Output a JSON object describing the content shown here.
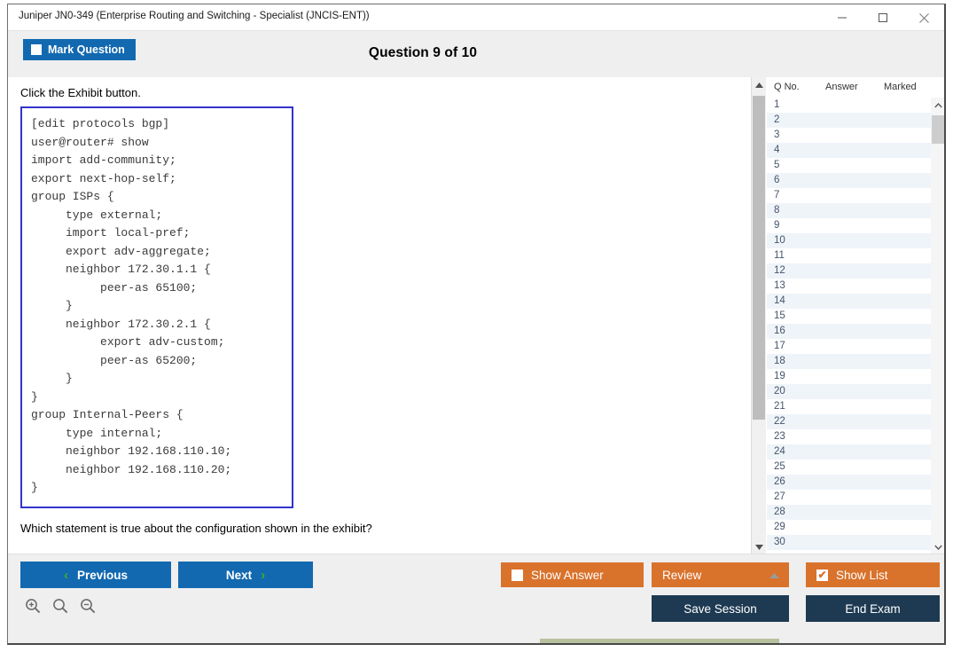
{
  "window": {
    "title": "Juniper JN0-349 (Enterprise Routing and Switching - Specialist (JNCIS-ENT))",
    "minimize_label": "minimize",
    "maximize_label": "maximize",
    "close_label": "close"
  },
  "header": {
    "mark_question_label": "Mark Question",
    "question_title": "Question 9 of 10"
  },
  "main": {
    "prompt": "Click the Exhibit button.",
    "exhibit_code": "[edit protocols bgp]\nuser@router# show\nimport add-community;\nexport next-hop-self;\ngroup ISPs {\n     type external;\n     import local-pref;\n     export adv-aggregate;\n     neighbor 172.30.1.1 {\n          peer-as 65100;\n     }\n     neighbor 172.30.2.1 {\n          export adv-custom;\n          peer-as 65200;\n     }\n}\ngroup Internal-Peers {\n     type internal;\n     neighbor 192.168.110.10;\n     neighbor 192.168.110.20;\n}",
    "question": "Which statement is true about the configuration shown in the exhibit?"
  },
  "question_list": {
    "columns": [
      "Q No.",
      "Answer",
      "Marked"
    ],
    "rows": [
      {
        "qno": "1",
        "answer": "",
        "marked": ""
      },
      {
        "qno": "2",
        "answer": "",
        "marked": ""
      },
      {
        "qno": "3",
        "answer": "",
        "marked": ""
      },
      {
        "qno": "4",
        "answer": "",
        "marked": ""
      },
      {
        "qno": "5",
        "answer": "",
        "marked": ""
      },
      {
        "qno": "6",
        "answer": "",
        "marked": ""
      },
      {
        "qno": "7",
        "answer": "",
        "marked": ""
      },
      {
        "qno": "8",
        "answer": "",
        "marked": ""
      },
      {
        "qno": "9",
        "answer": "",
        "marked": ""
      },
      {
        "qno": "10",
        "answer": "",
        "marked": ""
      },
      {
        "qno": "11",
        "answer": "",
        "marked": ""
      },
      {
        "qno": "12",
        "answer": "",
        "marked": ""
      },
      {
        "qno": "13",
        "answer": "",
        "marked": ""
      },
      {
        "qno": "14",
        "answer": "",
        "marked": ""
      },
      {
        "qno": "15",
        "answer": "",
        "marked": ""
      },
      {
        "qno": "16",
        "answer": "",
        "marked": ""
      },
      {
        "qno": "17",
        "answer": "",
        "marked": ""
      },
      {
        "qno": "18",
        "answer": "",
        "marked": ""
      },
      {
        "qno": "19",
        "answer": "",
        "marked": ""
      },
      {
        "qno": "20",
        "answer": "",
        "marked": ""
      },
      {
        "qno": "21",
        "answer": "",
        "marked": ""
      },
      {
        "qno": "22",
        "answer": "",
        "marked": ""
      },
      {
        "qno": "23",
        "answer": "",
        "marked": ""
      },
      {
        "qno": "24",
        "answer": "",
        "marked": ""
      },
      {
        "qno": "25",
        "answer": "",
        "marked": ""
      },
      {
        "qno": "26",
        "answer": "",
        "marked": ""
      },
      {
        "qno": "27",
        "answer": "",
        "marked": ""
      },
      {
        "qno": "28",
        "answer": "",
        "marked": ""
      },
      {
        "qno": "29",
        "answer": "",
        "marked": ""
      },
      {
        "qno": "30",
        "answer": "",
        "marked": ""
      }
    ]
  },
  "footer": {
    "previous_label": "Previous",
    "next_label": "Next",
    "previous_chevron": "‹",
    "next_chevron": "›",
    "show_answer_label": "Show Answer",
    "show_answer_checked": false,
    "review_label": "Review",
    "show_list_label": "Show List",
    "show_list_checked": true,
    "show_list_check_glyph": "✔",
    "save_session_label": "Save Session",
    "end_exam_label": "End Exam",
    "zoom_icons": [
      "zoom-in-icon",
      "zoom-reset-icon",
      "zoom-out-icon"
    ]
  },
  "colors": {
    "accent_blue": "#1269b0",
    "accent_orange": "#d9722b",
    "dark_navy": "#1e3a52",
    "exhibit_border": "#3333cc",
    "chevron_green": "#3fae29"
  }
}
